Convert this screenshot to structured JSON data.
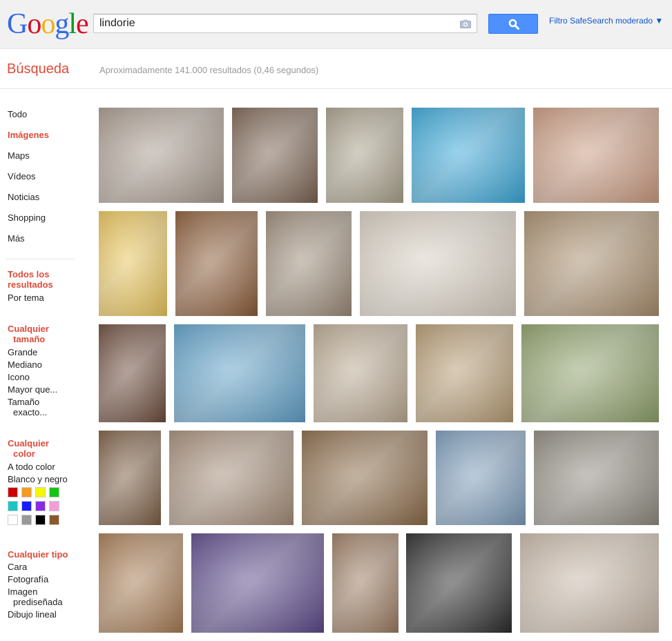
{
  "header": {
    "logo_text": "Google",
    "search_value": "lindorie",
    "safesearch_label": "Filtro SafeSearch moderado ▼"
  },
  "results_bar": {
    "section_title": "Búsqueda",
    "stats": "Aproximadamente 141.000 resultados (0,46 segundos)"
  },
  "sidebar": {
    "nav": [
      "Todo",
      "Imágenes",
      "Maps",
      "Vídeos",
      "Noticias",
      "Shopping",
      "Más"
    ],
    "active_nav": "Imágenes",
    "all_results": {
      "line1": "Todos los",
      "line2": "resultados",
      "by_topic": "Por tema"
    },
    "size": {
      "line1": "Cualquier",
      "line2": "tamaño",
      "options": [
        "Grande",
        "Mediano",
        "Icono",
        "Mayor que..."
      ],
      "exact1": "Tamaño",
      "exact2": "exacto..."
    },
    "color": {
      "line1": "Cualquier",
      "line2": "color",
      "options": [
        "A todo color",
        "Blanco y negro"
      ],
      "swatches": [
        "#cc0000",
        "#f59a23",
        "#f7f700",
        "#16c416",
        "#1fc4c4",
        "#1a1aff",
        "#8a2be2",
        "#f29ed6",
        "#ffffff",
        "#999999",
        "#000000",
        "#8b5a2b"
      ]
    },
    "type": {
      "header": "Cualquier tipo",
      "options": [
        "Cara",
        "Fotografía"
      ],
      "clipart1": "Imagen",
      "clipart2": "prediseñada",
      "lineart": "Dibujo lineal"
    }
  },
  "images": {
    "colors": [
      [
        "#a89a8e",
        "#7a6250",
        "#a8a08a",
        "#3aa7d8",
        "#c99a80"
      ],
      [
        "#e9c45a",
        "#8a5a36",
        "#9b8a78",
        "#d8cfc2",
        "#a88d6c"
      ],
      [
        "#6b4a3a",
        "#5fa0c8",
        "#b9a890",
        "#b59a72",
        "#8ea06a"
      ],
      [
        "#7a5c42",
        "#a48c78",
        "#8a6a48",
        "#7a9ab8",
        "#8f8a80"
      ],
      [
        "#a67a52",
        "#5c4a8a",
        "#9a7a60",
        "#2a2a2a",
        "#c8b8a8"
      ]
    ]
  }
}
